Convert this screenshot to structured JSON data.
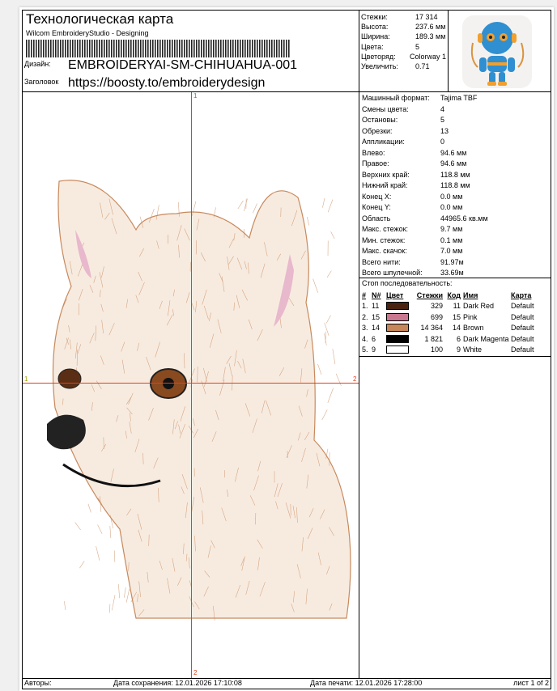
{
  "header": {
    "title": "Технологическая карта",
    "subtitle": "Wilcom EmbroideryStudio - Designing",
    "design_label": "Дизайн:",
    "design_value": "EMBROIDERYAI-SM-CHIHUAHUA-001",
    "heading_label": "Заголовок",
    "heading_value": "https://boosty.to/embroiderydesign"
  },
  "summary": [
    {
      "k": "Стежки:",
      "v": "17 314"
    },
    {
      "k": "Высота:",
      "v": "237.6 мм"
    },
    {
      "k": "Ширина:",
      "v": "189.3 мм"
    },
    {
      "k": "Цвета:",
      "v": "5"
    },
    {
      "k": "Цветоряд:",
      "v": "Colorway 1"
    },
    {
      "k": "Увеличить:",
      "v": "0.71"
    }
  ],
  "details": [
    {
      "k": "Машинный формат:",
      "v": "Tajima TBF"
    },
    {
      "k": "Смены цвета:",
      "v": "4"
    },
    {
      "k": "Остановы:",
      "v": "5"
    },
    {
      "k": "Обрезки:",
      "v": "13"
    },
    {
      "k": "Аппликации:",
      "v": "0"
    },
    {
      "k": "Влево:",
      "v": "94.6 мм"
    },
    {
      "k": "Правое:",
      "v": "94.6 мм"
    },
    {
      "k": "Верхних край:",
      "v": "118.8 мм"
    },
    {
      "k": "Нижний край:",
      "v": "118.8 мм"
    },
    {
      "k": "Конец X:",
      "v": "0.0 мм"
    },
    {
      "k": "Конец Y:",
      "v": "0.0 мм"
    },
    {
      "k": "Область",
      "v": "44965.6 кв.мм"
    },
    {
      "k": "Макс. стежок:",
      "v": "9.7 мм"
    },
    {
      "k": "Мин. стежок:",
      "v": "0.1 мм"
    },
    {
      "k": "Макс. скачок:",
      "v": "7.0 мм"
    },
    {
      "k": "Всего нити:",
      "v": "91.97м"
    },
    {
      "k": "Всего шпулечной:",
      "v": "33.69м"
    }
  ],
  "stops": {
    "title": "Стоп последовательность:",
    "headers": [
      "#",
      "N#",
      "Цвет",
      "Стежки",
      "Код",
      "Имя",
      "Карта"
    ],
    "rows": [
      {
        "i": "1.",
        "n": "11",
        "color": "#4a2210",
        "st": "329",
        "code": "11",
        "name": "Dark Red",
        "map": "Default"
      },
      {
        "i": "2.",
        "n": "15",
        "color": "#c9788f",
        "st": "699",
        "code": "15",
        "name": "Pink",
        "map": "Default"
      },
      {
        "i": "3.",
        "n": "14",
        "color": "#c6875a",
        "st": "14 364",
        "code": "14",
        "name": "Brown",
        "map": "Default"
      },
      {
        "i": "4.",
        "n": "6",
        "color": "#000000",
        "st": "1 821",
        "code": "6",
        "name": "Dark Magenta",
        "map": "Default"
      },
      {
        "i": "5.",
        "n": "9",
        "color": "#ffffff",
        "st": "100",
        "code": "9",
        "name": "White",
        "map": "Default"
      }
    ]
  },
  "markers": {
    "top": "1",
    "bottom": "2",
    "left": "1",
    "right": "2"
  },
  "footer": {
    "authors": "Авторы:",
    "saved": "Дата сохранения: 12.01.2026 17:10:08",
    "printed": "Дата печати: 12.01.2026 17:28:00",
    "sheet": "лист 1 of 2"
  }
}
